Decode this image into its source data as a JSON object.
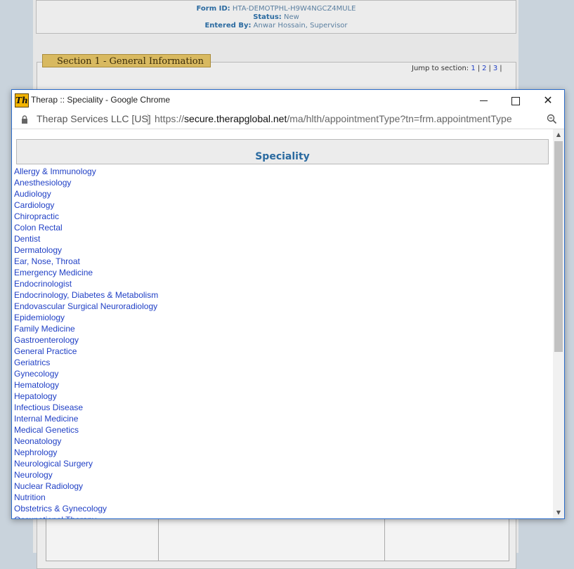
{
  "background_form": {
    "form_id_label": "Form ID:",
    "form_id_value": "HTA-DEMOTPHL-H9W4NGCZ4MULE",
    "status_label": "Status:",
    "status_value": "New",
    "entered_by_label": "Entered By:",
    "entered_by_value": "Anwar Hossain, Supervisor",
    "section_tab": "Section 1 - General Information",
    "jump_label": "Jump to section:",
    "jump_links": [
      "1",
      "2",
      "3"
    ]
  },
  "window": {
    "title": "Therap :: Speciality - Google Chrome",
    "icon_text": "Th",
    "site_identity": "Therap Services LLC [US]",
    "url_scheme": "https://",
    "url_host": "secure.therapglobal.net",
    "url_path": "/ma/hlth/appointmentType?tn=frm.appointmentType"
  },
  "speciality": {
    "header": "Speciality",
    "items": [
      "Allergy & Immunology",
      "Anesthesiology",
      "Audiology",
      "Cardiology",
      "Chiropractic",
      "Colon Rectal",
      "Dentist",
      "Dermatology",
      "Ear, Nose, Throat",
      "Emergency Medicine",
      "Endocrinologist",
      "Endocrinology, Diabetes & Metabolism",
      "Endovascular Surgical Neuroradiology",
      "Epidemiology",
      "Family Medicine",
      "Gastroenterology",
      "General Practice",
      "Geriatrics",
      "Gynecology",
      "Hematology",
      "Hepatology",
      "Infectious Disease",
      "Internal Medicine",
      "Medical Genetics",
      "Neonatology",
      "Nephrology",
      "Neurological Surgery",
      "Neurology",
      "Nuclear Radiology",
      "Nutrition",
      "Obstetrics & Gynecology",
      "Occupational Therapy"
    ]
  }
}
